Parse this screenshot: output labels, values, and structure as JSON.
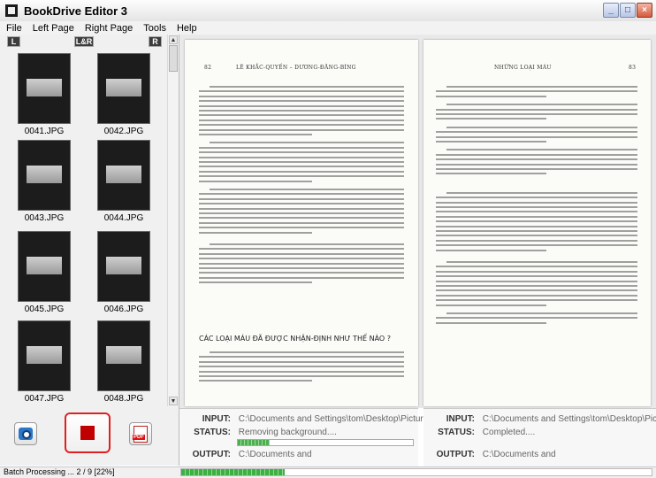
{
  "window": {
    "title": "BookDrive Editor 3",
    "controls": [
      "_",
      "□",
      "×"
    ]
  },
  "menu": [
    "File",
    "Left Page",
    "Right Page",
    "Tools",
    "Help"
  ],
  "view_tabs": {
    "left": "L",
    "both": "L&R",
    "right": "R"
  },
  "thumbnails": [
    "0041.JPG",
    "0042.JPG",
    "0043.JPG",
    "0044.JPG",
    "0045.JPG",
    "0046.JPG",
    "0047.JPG",
    "0048.JPG"
  ],
  "buttons": {
    "pdf_label": "PDF"
  },
  "viewer": {
    "left_header": "LÊ KHẮC-QUYẾN – DƯƠNG-ĐĂNG-BÌNG",
    "left_page_number": "82",
    "right_header": "NHỮNG LOẠI MÁU",
    "right_page_number": "83",
    "left_heading": "CÁC LOẠI MÁU ĐÃ ĐƯỢC NHẬN-ĐỊNH NHƯ THẾ NÀO ?"
  },
  "status_left": {
    "input_label": "INPUT:",
    "input_value": "C:\\Documents and Settings\\tom\\Desktop\\Picture",
    "status_label": "STATUS:",
    "status_value": "Removing background....",
    "output_label": "OUTPUT:",
    "output_value": "C:\\Documents and",
    "progress": 0.18
  },
  "status_right": {
    "input_label": "INPUT:",
    "input_value": "C:\\Documents and Settings\\tom\\Desktop\\Picture",
    "status_label": "STATUS:",
    "status_value": "Completed....",
    "output_label": "OUTPUT:",
    "output_value": "C:\\Documents and"
  },
  "statusbar": {
    "text": "Batch Processing ... 2 / 9 [22%]",
    "progress": 0.22
  },
  "colors": {
    "stop": "#c00000",
    "stop_border": "#e02020",
    "progress": "#4caf50"
  }
}
